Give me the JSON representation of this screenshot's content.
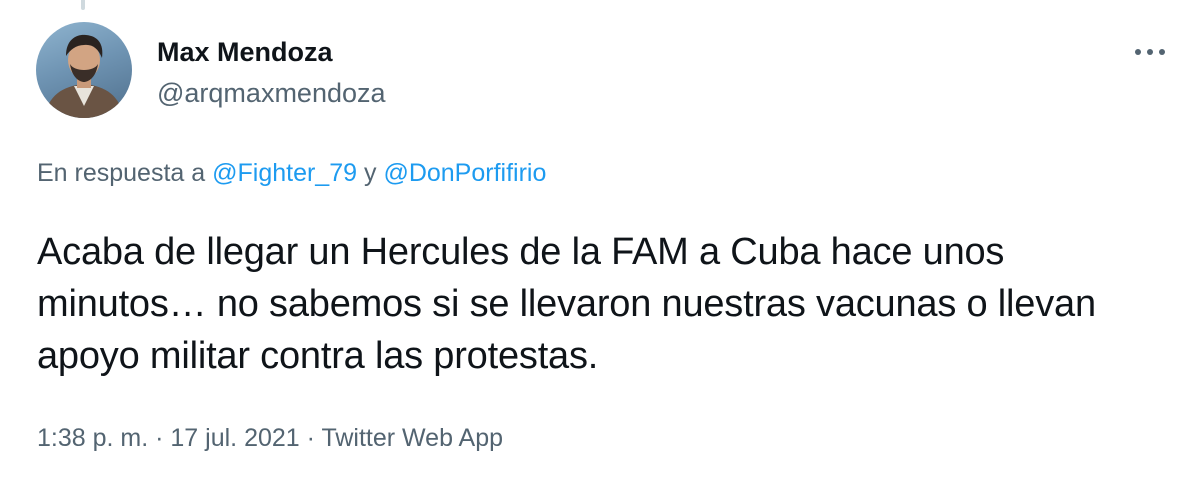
{
  "author": {
    "display_name": "Max Mendoza",
    "handle": "@arqmaxmendoza",
    "avatar_icon": "user-avatar"
  },
  "more_icon": "more-horizontal-icon",
  "reply": {
    "prefix": "En respuesta a",
    "mention_1": "@Fighter_79",
    "conjunction": "y",
    "mention_2": "@DonPorfifirio"
  },
  "tweet": {
    "text": "Acaba de llegar un Hercules de la FAM a Cuba hace unos minutos… no sabemos si se llevaron nuestras vacunas o llevan apoyo militar contra las protestas."
  },
  "meta": {
    "time": "1:38 p. m.",
    "separator": "·",
    "date": "17 jul. 2021",
    "source": "Twitter Web App"
  },
  "colors": {
    "text_primary": "#0f1419",
    "text_secondary": "#536471",
    "link": "#1d9bf0",
    "thread_line": "#cfd9de"
  }
}
